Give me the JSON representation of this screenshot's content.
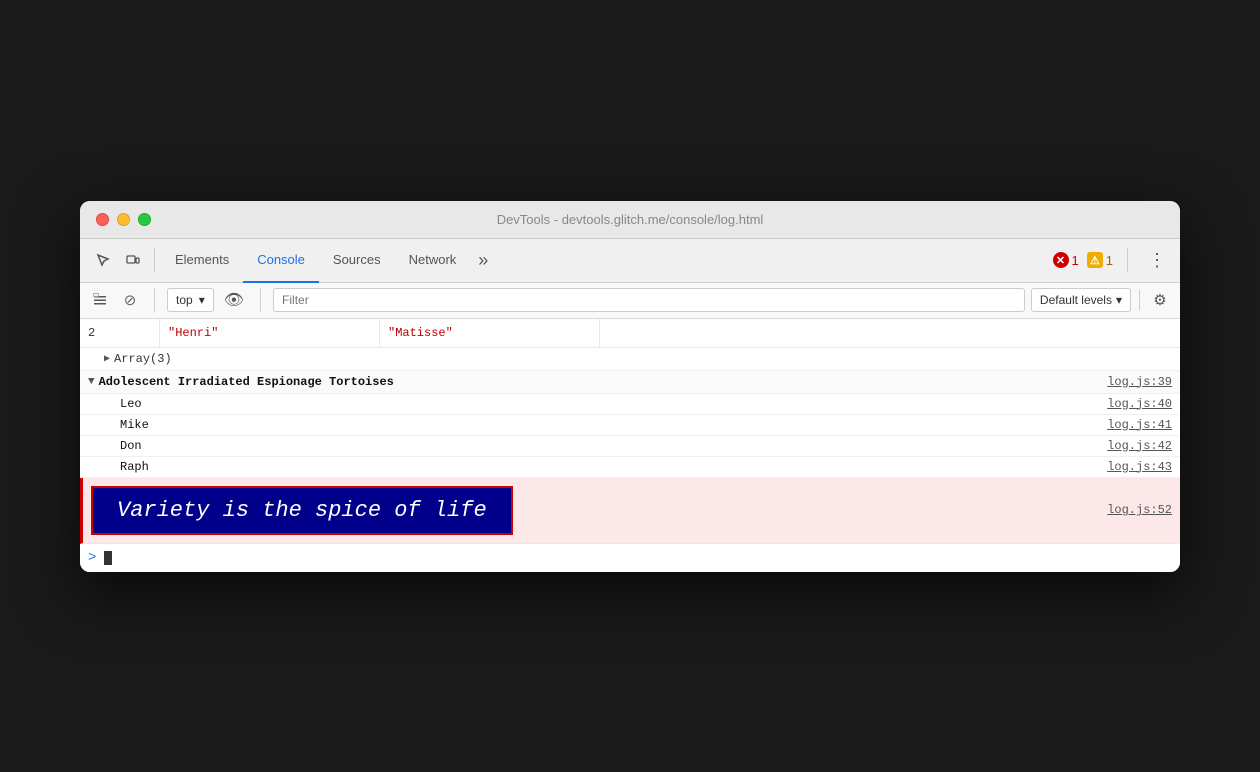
{
  "window": {
    "title": "DevTools - devtools.glitch.me/console/log.html"
  },
  "tabs": [
    {
      "id": "elements",
      "label": "Elements",
      "active": false
    },
    {
      "id": "console",
      "label": "Console",
      "active": true
    },
    {
      "id": "sources",
      "label": "Sources",
      "active": false
    },
    {
      "id": "network",
      "label": "Network",
      "active": false
    }
  ],
  "toolbar": {
    "more_label": "»",
    "error_count": "1",
    "warn_count": "1",
    "more_options_label": "⋮"
  },
  "console_toolbar": {
    "context_label": "top",
    "filter_placeholder": "Filter",
    "levels_label": "Default levels",
    "levels_arrow": "▾"
  },
  "console": {
    "table_row": {
      "index": "2",
      "firstname": "\"Henri\"",
      "lastname": "\"Matisse\""
    },
    "array_label": "▶ Array(3)",
    "group": {
      "title": "Adolescent Irradiated Espionage Tortoises",
      "link": "log.js:39",
      "items": [
        {
          "text": "Leo",
          "link": "log.js:40"
        },
        {
          "text": "Mike",
          "link": "log.js:41"
        },
        {
          "text": "Don",
          "link": "log.js:42"
        },
        {
          "text": "Raph",
          "link": "log.js:43"
        }
      ]
    },
    "styled_log": {
      "text": "Variety is the spice of life",
      "link": "log.js:52"
    },
    "prompt_symbol": ">"
  }
}
